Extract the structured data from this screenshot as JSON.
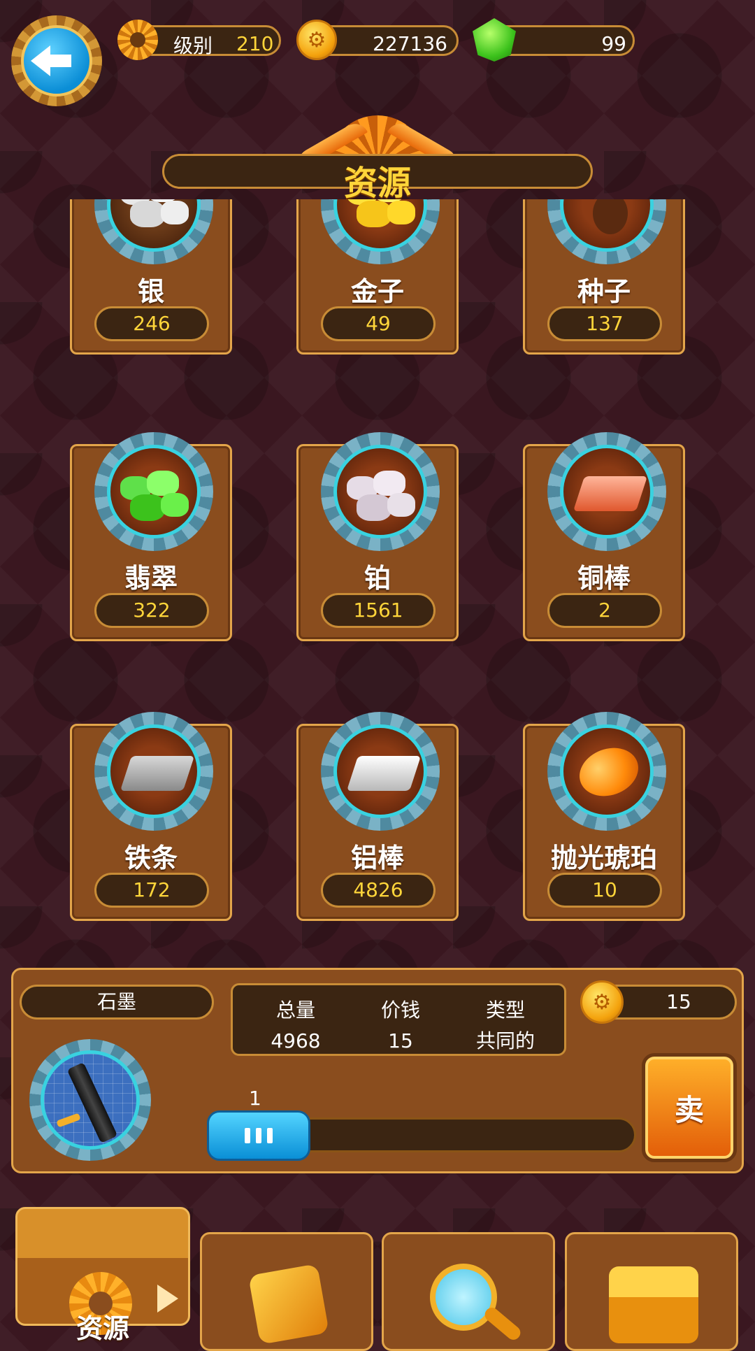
{
  "header": {
    "level_label": "级别",
    "level_value": "210",
    "coins": "227136",
    "gems": "99"
  },
  "title": "资源",
  "resources": [
    {
      "name": "银",
      "count": "246",
      "icon": "silver-ore-icon"
    },
    {
      "name": "金子",
      "count": "49",
      "icon": "gold-ore-icon"
    },
    {
      "name": "种子",
      "count": "137",
      "icon": "seed-icon"
    },
    {
      "name": "翡翠",
      "count": "322",
      "icon": "emerald-icon"
    },
    {
      "name": "铂",
      "count": "1561",
      "icon": "platinum-ore-icon"
    },
    {
      "name": "铜棒",
      "count": "2",
      "icon": "copper-bar-icon"
    },
    {
      "name": "铁条",
      "count": "172",
      "icon": "iron-bar-icon"
    },
    {
      "name": "铝棒",
      "count": "4826",
      "icon": "aluminum-bar-icon"
    },
    {
      "name": "抛光琥珀",
      "count": "10",
      "icon": "polished-amber-icon"
    }
  ],
  "detail": {
    "name": "石墨",
    "stats": [
      {
        "label": "总量",
        "value": "4968"
      },
      {
        "label": "价钱",
        "value": "15"
      },
      {
        "label": "类型",
        "value": "共同的"
      }
    ],
    "price": "15",
    "quantity": "1",
    "sell_label": "卖",
    "quantity_fraction": 0
  },
  "tabs": [
    {
      "label": "资源",
      "icon": "gear-icon",
      "active": true
    },
    {
      "label": "",
      "icon": "dice-icon",
      "active": false
    },
    {
      "label": "",
      "icon": "magnifier-icon",
      "active": false
    },
    {
      "label": "",
      "icon": "treasure-chest-icon",
      "active": false
    }
  ],
  "colors": {
    "background": "#3a1720",
    "card": "#8a4d1e",
    "accent_yellow": "#ffd53a",
    "gear_cyan": "#39d2e0"
  }
}
